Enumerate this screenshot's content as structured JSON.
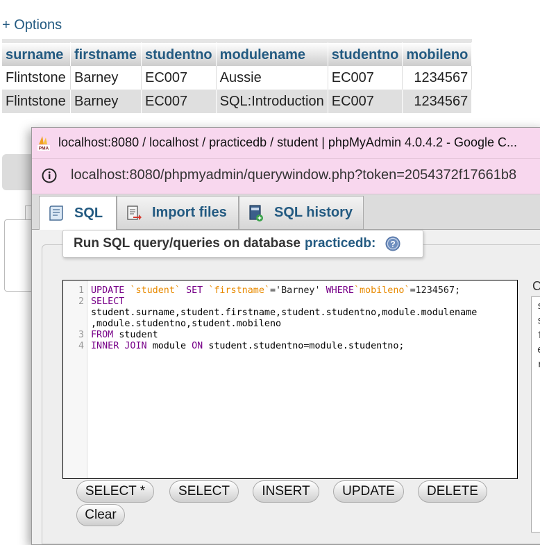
{
  "page": {
    "options_link": "+ Options"
  },
  "results": {
    "columns": [
      "surname",
      "firstname",
      "studentno",
      "modulename",
      "studentno",
      "mobileno"
    ],
    "rows": [
      [
        "Flintstone",
        "Barney",
        "EC007",
        "Aussie",
        "EC007",
        "1234567"
      ],
      [
        "Flintstone",
        "Barney",
        "EC007",
        "SQL:Introduction",
        "EC007",
        "1234567"
      ]
    ]
  },
  "popup": {
    "window_title": "localhost:8080 / localhost / practicedb / student | phpMyAdmin 4.0.4.2 - Google C...",
    "url": "localhost:8080/phpmyadmin/querywindow.php?token=2054372f17661b8",
    "logo_text": "PMA",
    "tabs": [
      {
        "label": "SQL",
        "icon": "sql-icon"
      },
      {
        "label": "Import files",
        "icon": "import-icon"
      },
      {
        "label": "SQL history",
        "icon": "history-icon"
      }
    ],
    "query_header": {
      "prefix": "Run SQL query/queries on database",
      "database": "practicedb:",
      "help_icon": "help-icon"
    },
    "editor": {
      "line_numbers": [
        "1",
        "2",
        "3",
        "4"
      ],
      "line1": {
        "kw1": "UPDATE",
        "id1": "`student`",
        "kw2": "SET",
        "id2": "`firstname`",
        "rest1": "='Barney'",
        "kw3": "WHERE",
        "id3": "`mobileno`",
        "rest2": "=1234567;"
      },
      "line2": {
        "kw": "SELECT"
      },
      "line2_wrap1": "student.surname,student.firstname,student.studentno,module.modulename",
      "line2_wrap2": ",module.studentno,student.mobileno",
      "line3": {
        "kw": "FROM",
        "rest": "student"
      },
      "line4": {
        "kw1": "INNER JOIN",
        "mid": "module",
        "kw2": "ON",
        "rest": "student.studentno=module.studentno;"
      }
    },
    "side_label": "C",
    "side_letters": [
      "s",
      "s",
      "f",
      "e",
      "r"
    ],
    "buttons": [
      "SELECT *",
      "SELECT",
      "INSERT",
      "UPDATE",
      "DELETE",
      "Clear"
    ],
    "colors": {
      "titlebar": "#f8d7ee",
      "link": "#235a81",
      "keyword": "#770088",
      "identifier": "#e88a00"
    }
  }
}
